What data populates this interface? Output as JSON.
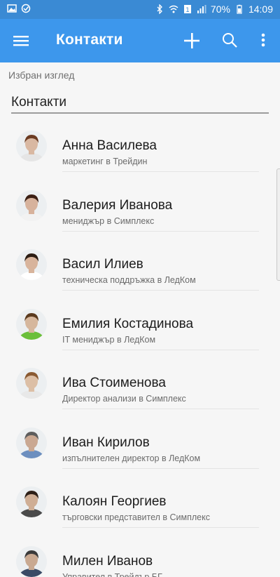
{
  "status_bar": {
    "battery": "70%",
    "time": "14:09",
    "icons": [
      "gallery-icon",
      "check-icon",
      "bluetooth-icon",
      "wifi-icon",
      "sim-icon",
      "signal-icon",
      "battery-icon"
    ]
  },
  "app_bar": {
    "title": "Контакти",
    "actions": [
      "menu-icon",
      "add-icon",
      "search-icon",
      "more-icon"
    ]
  },
  "view": {
    "label": "Избран изглед",
    "selected": "Контакти"
  },
  "contacts": [
    {
      "name": "Анна Василева",
      "role": "маркетинг в Трейдин"
    },
    {
      "name": "Валерия Иванова",
      "role": "мениджър в Симплекс"
    },
    {
      "name": "Васил Илиев",
      "role": "техническа поддръжка в ЛедКом"
    },
    {
      "name": "Емилия Костадинова",
      "role": "IT мениджър в ЛедКом"
    },
    {
      "name": "Ива Стоименова",
      "role": "Директор анализи в Симплекс"
    },
    {
      "name": "Иван Кирилов",
      "role": "изпълнителен директор в ЛедКом"
    },
    {
      "name": "Калоян Георгиев",
      "role": "търговски представител в Симплекс"
    },
    {
      "name": "Милен Иванов",
      "role": "Управител в Трейдър БГ"
    }
  ],
  "colors": {
    "status_bar": "#3a8ad4",
    "app_bar": "#3d97ec",
    "background": "#f6f6f6"
  }
}
